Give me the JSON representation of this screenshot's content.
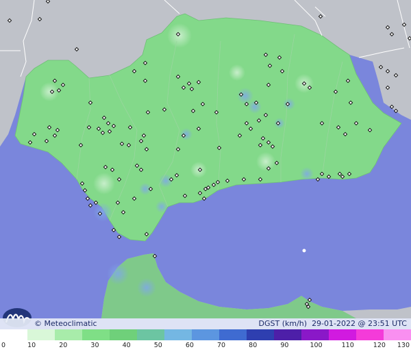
{
  "map": {
    "brand": "© Meteoclimatic",
    "variable_label": "DGST (km/h)",
    "timestamp": "29-01-2022 @ 23:51 UTC",
    "colors": {
      "sea": "#7a86dc",
      "land_outside": "#bfc2c9",
      "land_region": "#83d98a",
      "border_lines": "#ffffff",
      "station_marker": "#1a1a1a"
    },
    "scale": {
      "labels": [
        "0",
        "10",
        "20",
        "30",
        "40",
        "50",
        "60",
        "70",
        "80",
        "90",
        "100",
        "110",
        "120",
        "130"
      ],
      "colors": [
        "#ffffff",
        "#d9f7d8",
        "#a8ecaa",
        "#7fdf86",
        "#6fd07a",
        "#6cc5a2",
        "#74b7e3",
        "#5c96e0",
        "#3f6bd1",
        "#2e3fb0",
        "#4d1fa8",
        "#8a18c8",
        "#d11ae0",
        "#f43bd9",
        "#f98ff0"
      ]
    }
  }
}
